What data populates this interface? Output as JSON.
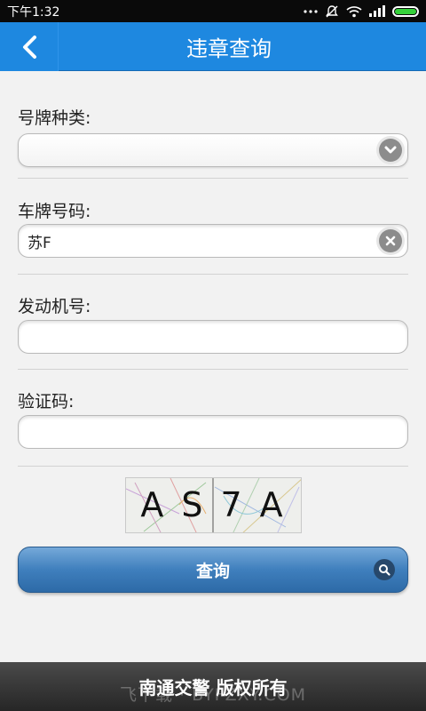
{
  "status_bar": {
    "time": "下午1:32",
    "icons": [
      "more-dots-icon",
      "notifications-muted-icon",
      "wifi-icon",
      "signal-icon",
      "battery-icon"
    ],
    "battery_color": "#35d13a"
  },
  "header": {
    "title": "违章查询",
    "background": "#1e88e0"
  },
  "form": {
    "plate_type": {
      "label": "号牌种类:",
      "value": ""
    },
    "plate_number": {
      "label": "车牌号码:",
      "value": "苏F"
    },
    "engine_number": {
      "label": "发动机号:",
      "value": ""
    },
    "captcha_field": {
      "label": "验证码:",
      "value": ""
    },
    "captcha_text": "AS7A"
  },
  "query_button": {
    "label": "查询"
  },
  "footer": {
    "text": "南通交警 版权所有",
    "watermark": "飞下载 · BYFZXY.COM"
  }
}
